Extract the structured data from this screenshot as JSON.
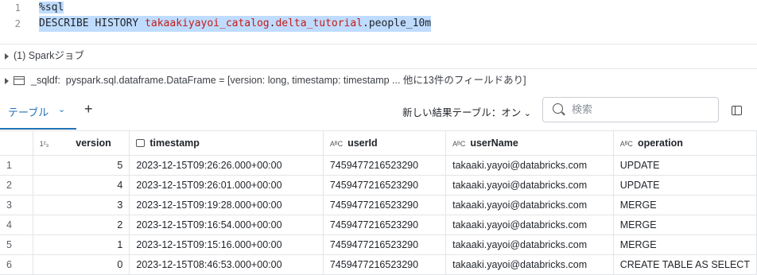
{
  "code": {
    "lines": [
      {
        "num": "1",
        "magic": "%sql"
      },
      {
        "num": "2",
        "kw1": "DESCRIBE",
        "kw2": "HISTORY",
        "catalog": "takaakiyayoi_catalog",
        "schema": "delta_tutorial",
        "table": "people_10m"
      }
    ]
  },
  "info": {
    "spark_jobs": "(1) Sparkジョブ",
    "df_name": "_sqldf:",
    "df_type": "pyspark.sql.dataframe.DataFrame = [version: long, timestamp: timestamp ... 他に13件のフィールドあり]"
  },
  "toolbar": {
    "tab_label": "テーブル",
    "toggle_label": "新しい結果テーブル：オン",
    "search_placeholder": "検索"
  },
  "table": {
    "columns": [
      {
        "type_icon": "1²₃",
        "label": "version"
      },
      {
        "type_icon": "calendar",
        "label": "timestamp"
      },
      {
        "type_icon": "AᴮC",
        "label": "userId"
      },
      {
        "type_icon": "AᴮC",
        "label": "userName"
      },
      {
        "type_icon": "AᴮC",
        "label": "operation"
      }
    ],
    "rows": [
      {
        "idx": "1",
        "version": "5",
        "timestamp": "2023-12-15T09:26:26.000+00:00",
        "userId": "7459477216523290",
        "userName": "takaaki.yayoi@databricks.com",
        "operation": "UPDATE"
      },
      {
        "idx": "2",
        "version": "4",
        "timestamp": "2023-12-15T09:26:01.000+00:00",
        "userId": "7459477216523290",
        "userName": "takaaki.yayoi@databricks.com",
        "operation": "UPDATE"
      },
      {
        "idx": "3",
        "version": "3",
        "timestamp": "2023-12-15T09:19:28.000+00:00",
        "userId": "7459477216523290",
        "userName": "takaaki.yayoi@databricks.com",
        "operation": "MERGE"
      },
      {
        "idx": "4",
        "version": "2",
        "timestamp": "2023-12-15T09:16:54.000+00:00",
        "userId": "7459477216523290",
        "userName": "takaaki.yayoi@databricks.com",
        "operation": "MERGE"
      },
      {
        "idx": "5",
        "version": "1",
        "timestamp": "2023-12-15T09:15:16.000+00:00",
        "userId": "7459477216523290",
        "userName": "takaaki.yayoi@databricks.com",
        "operation": "MERGE"
      },
      {
        "idx": "6",
        "version": "0",
        "timestamp": "2023-12-15T08:46:53.000+00:00",
        "userId": "7459477216523290",
        "userName": "takaaki.yayoi@databricks.com",
        "operation": "CREATE TABLE AS SELECT"
      }
    ]
  }
}
